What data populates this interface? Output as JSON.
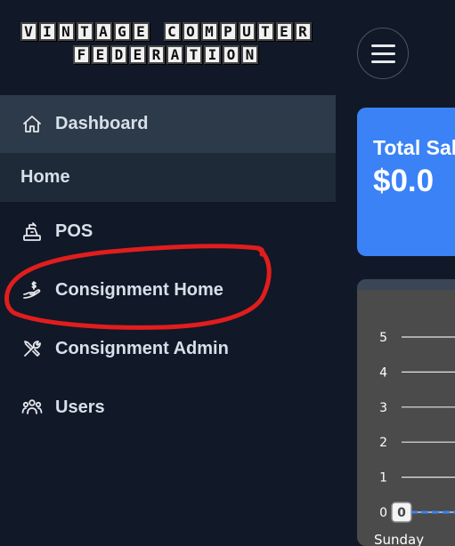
{
  "logo": {
    "line1": [
      "V",
      "I",
      "N",
      "T",
      "A",
      "G",
      "E",
      " ",
      "C",
      "O",
      "M",
      "P",
      "U",
      "T",
      "E",
      "R"
    ],
    "line2": [
      "F",
      "E",
      "D",
      "E",
      "R",
      "A",
      "T",
      "I",
      "O",
      "N"
    ]
  },
  "sidebar": {
    "items": [
      {
        "label": "Dashboard",
        "icon": "home-icon"
      },
      {
        "label": "Home"
      },
      {
        "label": "POS",
        "icon": "cash-register-icon"
      },
      {
        "label": "Consignment Home",
        "icon": "hand-dollar-icon"
      },
      {
        "label": "Consignment Admin",
        "icon": "tools-icon"
      },
      {
        "label": "Users",
        "icon": "users-icon"
      }
    ]
  },
  "card": {
    "title": "Total Sal",
    "value": "$0.0",
    "color": "#3b82f6"
  },
  "annotation": {
    "color": "#e11d1d"
  },
  "chart_data": {
    "type": "line",
    "categories": [
      "Sunday"
    ],
    "series": [
      {
        "values": [
          0
        ]
      }
    ],
    "yticks": [
      "5",
      "4",
      "3",
      "2",
      "1",
      "0"
    ],
    "ylim": [
      0,
      5
    ],
    "data_labels": [
      "0"
    ],
    "grid": true
  }
}
